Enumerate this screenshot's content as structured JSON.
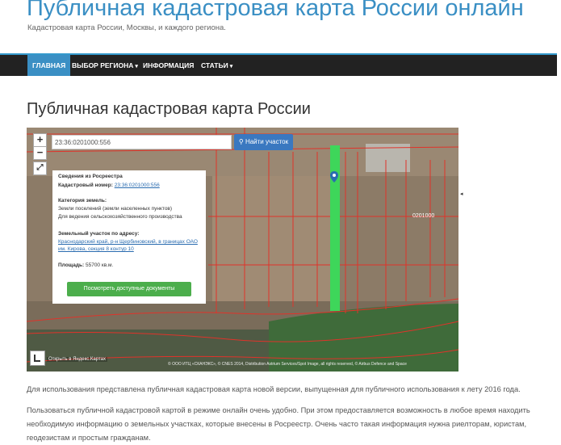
{
  "site": {
    "title": "Публичная кадастровая карта России онлайн",
    "description": "Кадастровая карта России, Москвы, и каждого региона."
  },
  "nav": {
    "items": [
      {
        "label": "ГЛАВНАЯ",
        "active": true
      },
      {
        "label": "ВЫБОР РЕГИОНА",
        "dropdown": true
      },
      {
        "label": "ИНФОРМАЦИЯ"
      },
      {
        "label": "СТАТЬИ",
        "dropdown": true
      }
    ],
    "caret": "▾"
  },
  "page": {
    "heading": "Публичная кадастровая карта России"
  },
  "map": {
    "zoom_in": "+",
    "zoom_out": "−",
    "fullscreen_icon": "⤢",
    "search_value": "23:36:0201000:556",
    "search_button": "Найти участок",
    "panel": {
      "source": "Сведения из Росреестра",
      "cadastral_label": "Кадастровый номер:",
      "cadastral_value": "23:36:0201000:556",
      "category_label": "Категория земель:",
      "category_value": "Земли поселений (земли населенных пунктов)",
      "usage_value": "Для ведения сельскохозяйственного производства",
      "address_label": "Земельный участок по адресу:",
      "address_line1": "Краснодарский край, р-н Щербиновский, в границах ОАО",
      "address_line2": "им. Кирова, секция 8 контур 10",
      "area_label": "Площадь:",
      "area_value": "55700 кв.м.",
      "docs_button": "Посмотреть доступные документы"
    },
    "yandex_link": "Открыть в Яндекс.Картах",
    "copyright": "© ООО ИТЦ «СКАНЭКС», © CNES 2014, Distribution Astrium Services/Spot Image, all rights reserved, © Airbus Defence and Space",
    "parcel_label": "0201000"
  },
  "content": {
    "para1": "Для использования представлена публичная кадастровая карта новой версии, выпущенная для публичного использования к лету 2016 года.",
    "para2": "Пользоваться публичной кадастровой картой в режиме онлайн очень удобно. При этом предоставляется возможность в любое время находить необходимую информацию о земельных участках, которые внесены в Росреестр. Очень часто такая информация нужна риелторам, юристам, геодезистам и простым гражданам."
  },
  "colors": {
    "accent": "#3a8fc4",
    "nav_bg": "#222222",
    "button_green": "#4cae4c",
    "parcel_green": "#3ed65a"
  }
}
